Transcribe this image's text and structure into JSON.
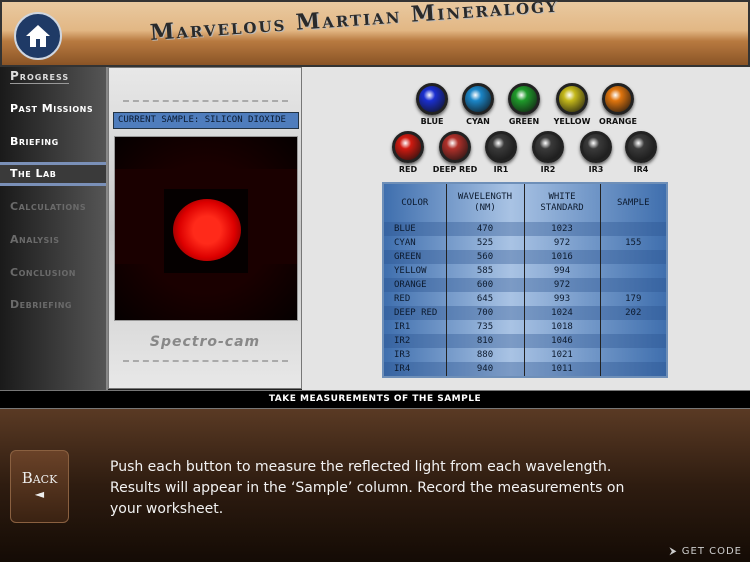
{
  "header": {
    "title": "Marvelous Martian Mineralogy"
  },
  "sidebar": {
    "heading": "Progress",
    "items": [
      {
        "label": "Past Missions",
        "state": "enabled"
      },
      {
        "label": "Briefing",
        "state": "enabled"
      },
      {
        "label": "The Lab",
        "state": "active"
      },
      {
        "label": "Calculations",
        "state": "disabled"
      },
      {
        "label": "Analysis",
        "state": "disabled"
      },
      {
        "label": "Conclusion",
        "state": "disabled"
      },
      {
        "label": "Debriefing",
        "state": "disabled"
      }
    ]
  },
  "camera": {
    "current_sample": "CURRENT SAMPLE: SILICON DIOXIDE",
    "brand": "Spectro-cam"
  },
  "buttons": [
    {
      "label": "BLUE",
      "color": "#1a2fd0"
    },
    {
      "label": "CYAN",
      "color": "#1b86c8"
    },
    {
      "label": "GREEN",
      "color": "#1f9a2a"
    },
    {
      "label": "YELLOW",
      "color": "#c4b81a"
    },
    {
      "label": "ORANGE",
      "color": "#e0750e"
    },
    {
      "label": "RED",
      "color": "#d01a10"
    },
    {
      "label": "DEEP RED",
      "color": "#b0302a"
    },
    {
      "label": "IR1",
      "color": "#3a3a3a"
    },
    {
      "label": "IR2",
      "color": "#3a3a3a"
    },
    {
      "label": "IR3",
      "color": "#3a3a3a"
    },
    {
      "label": "IR4",
      "color": "#3a3a3a"
    }
  ],
  "table": {
    "headers": [
      "COLOR",
      "WAVELENGTH (NM)",
      "WHITE STANDARD",
      "SAMPLE"
    ],
    "rows": [
      [
        "BLUE",
        "470",
        "1023",
        ""
      ],
      [
        "CYAN",
        "525",
        "972",
        "155"
      ],
      [
        "GREEN",
        "560",
        "1016",
        ""
      ],
      [
        "YELLOW",
        "585",
        "994",
        ""
      ],
      [
        "ORANGE",
        "600",
        "972",
        ""
      ],
      [
        "RED",
        "645",
        "993",
        "179"
      ],
      [
        "DEEP RED",
        "700",
        "1024",
        "202"
      ],
      [
        "IR1",
        "735",
        "1018",
        ""
      ],
      [
        "IR2",
        "810",
        "1046",
        ""
      ],
      [
        "IR3",
        "880",
        "1021",
        ""
      ],
      [
        "IR4",
        "940",
        "1011",
        ""
      ]
    ]
  },
  "instruction_bar": "TAKE MEASUREMENTS OF THE SAMPLE",
  "message": "Push each button to measure the reflected light from each wavelength. Results will appear in the ‘Sample’ column. Record the measurements on your worksheet.",
  "back_label": "Back",
  "get_code_label": "GET CODE"
}
